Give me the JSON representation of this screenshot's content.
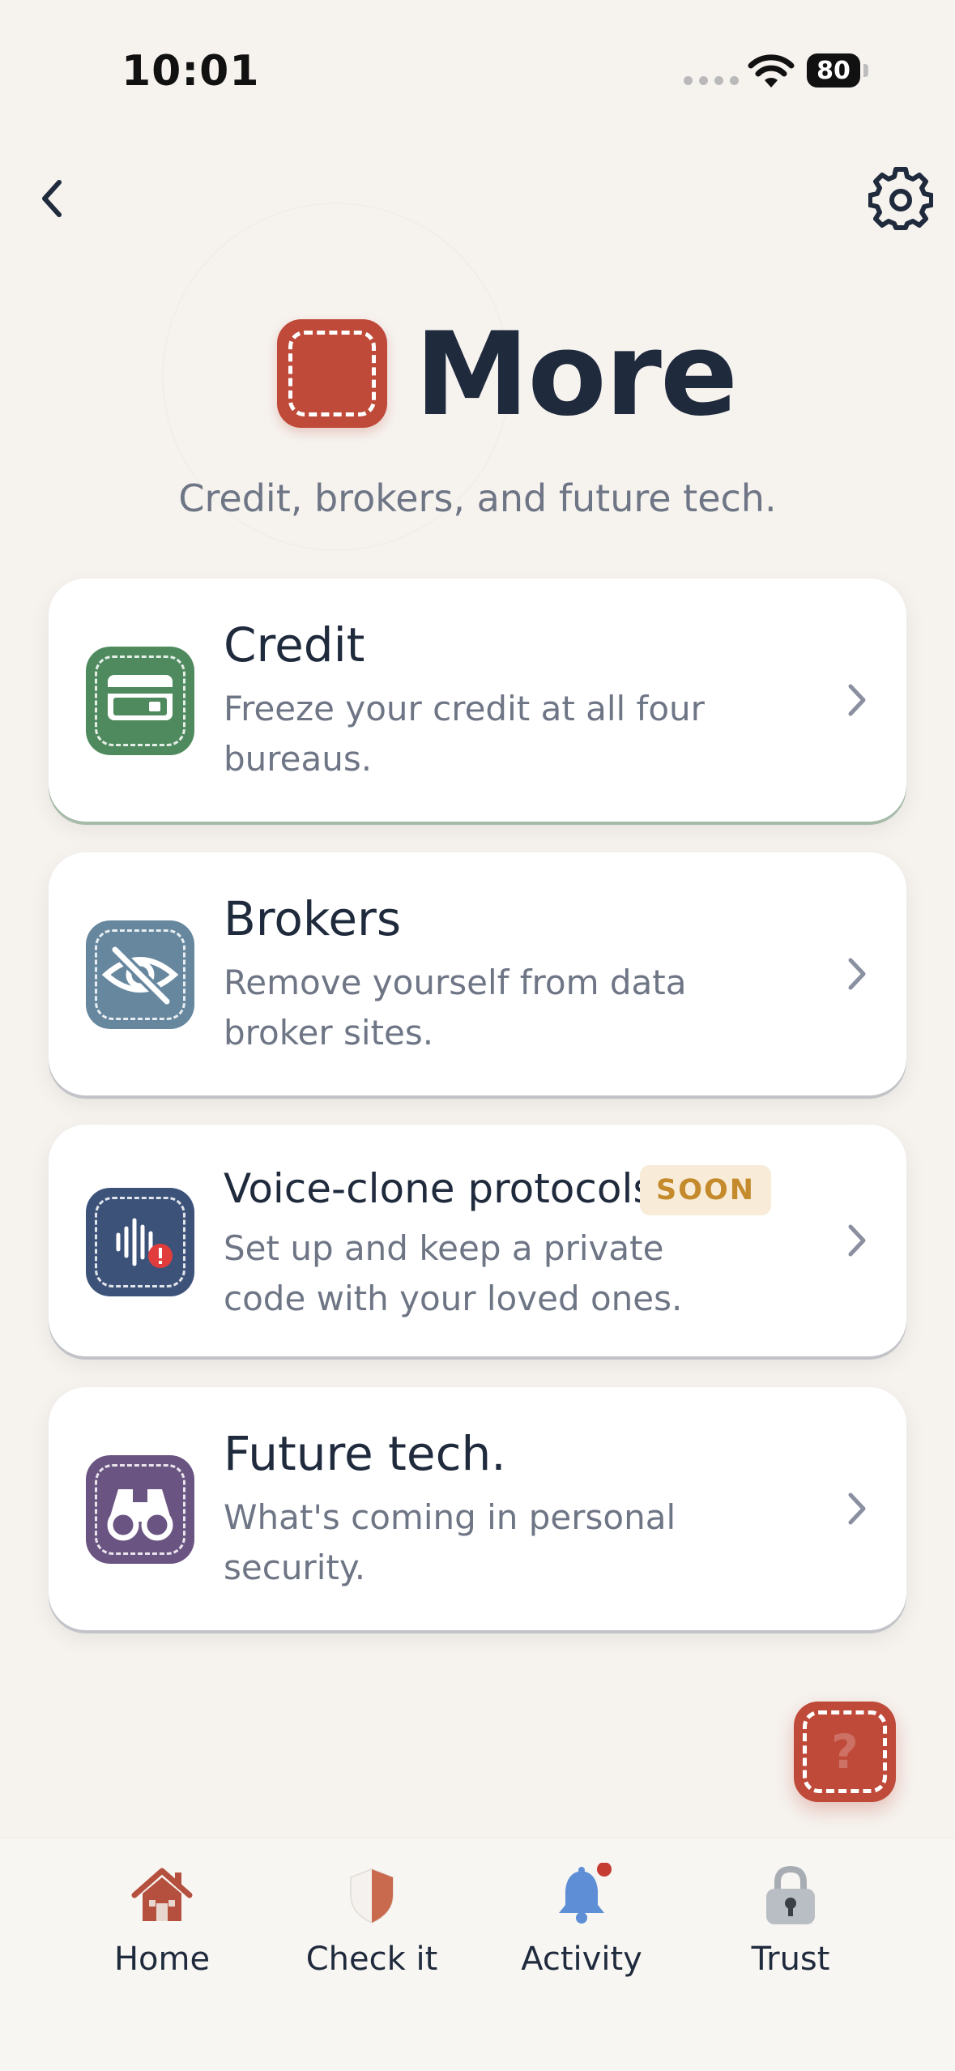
{
  "status_bar": {
    "time": "10:01",
    "battery": "80"
  },
  "header": {
    "title": "More",
    "subtitle": "Credit, brokers, and future tech."
  },
  "cards": [
    {
      "title": "Credit",
      "description": "Freeze your credit at all four bureaus.",
      "icon": "credit-card-icon",
      "color": "#4f8a5e"
    },
    {
      "title": "Brokers",
      "description": "Remove yourself from data broker sites.",
      "icon": "eye-slash-icon",
      "color": "#66879e"
    },
    {
      "title": "Voice-clone protocols",
      "badge": "SOON",
      "description": "Set up and keep a private code with your loved ones.",
      "icon": "voice-warning-icon",
      "color": "#3c5279"
    },
    {
      "title": "Future tech.",
      "description": "What's coming in personal security.",
      "icon": "binoculars-icon",
      "color": "#6a5481"
    }
  ],
  "help_fab": {
    "label": "?"
  },
  "tab_bar": {
    "items": [
      {
        "label": "Home",
        "icon": "home-icon"
      },
      {
        "label": "Check it",
        "icon": "shield-icon"
      },
      {
        "label": "Activity",
        "icon": "bell-icon"
      },
      {
        "label": "Trust",
        "icon": "lock-icon"
      }
    ]
  },
  "colors": {
    "brand": "#bf4a3a",
    "background": "#f6f3ef",
    "text_primary": "#1f2a3d",
    "text_secondary": "#6e7585",
    "badge_bg": "#f8ecd8",
    "badge_text": "#c58a2c"
  }
}
